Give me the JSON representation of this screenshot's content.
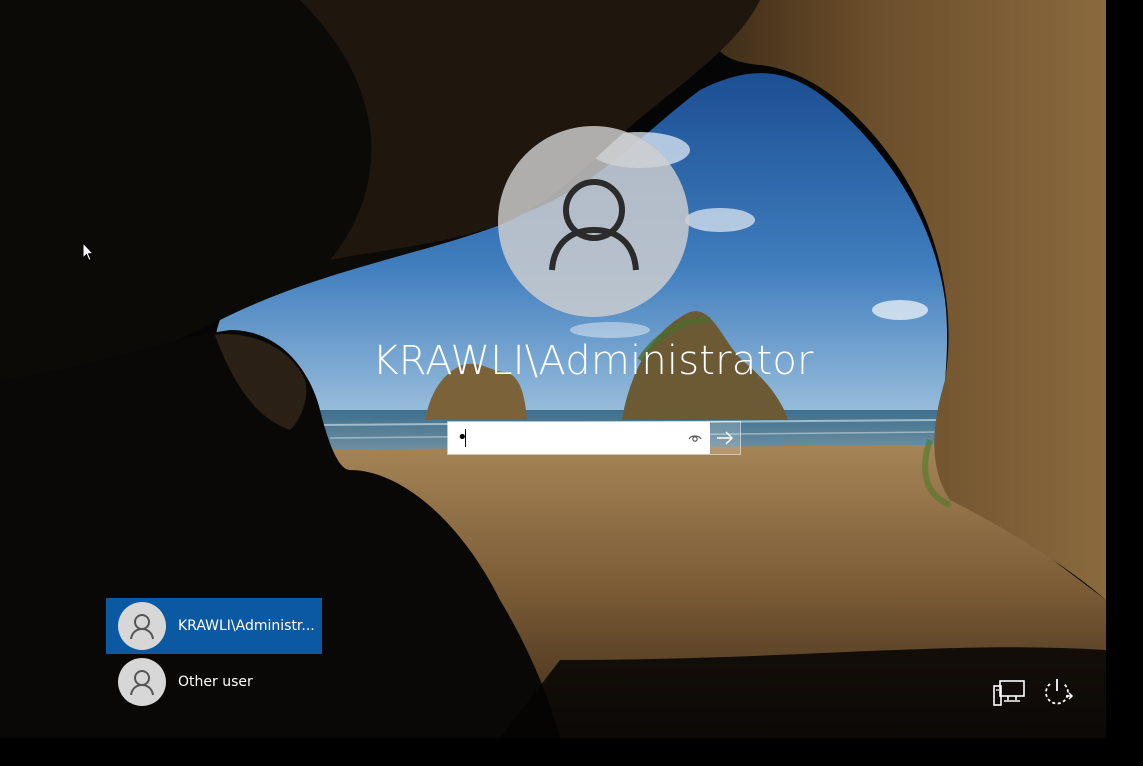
{
  "lock_screen": {
    "current_user": "KRAWLI\\Administrator",
    "password_masked": "•"
  },
  "user_list": [
    {
      "label": "KRAWLI\\Administr...",
      "selected": true
    },
    {
      "label": "Other user",
      "selected": false
    }
  ],
  "icons": {
    "avatar": "user-silhouette-icon",
    "reveal": "eye-icon",
    "submit": "arrow-right-icon",
    "network": "network-icon",
    "power": "power-icon"
  },
  "colors": {
    "selected_tile": "#0b59a2",
    "text": "#ffffff"
  }
}
